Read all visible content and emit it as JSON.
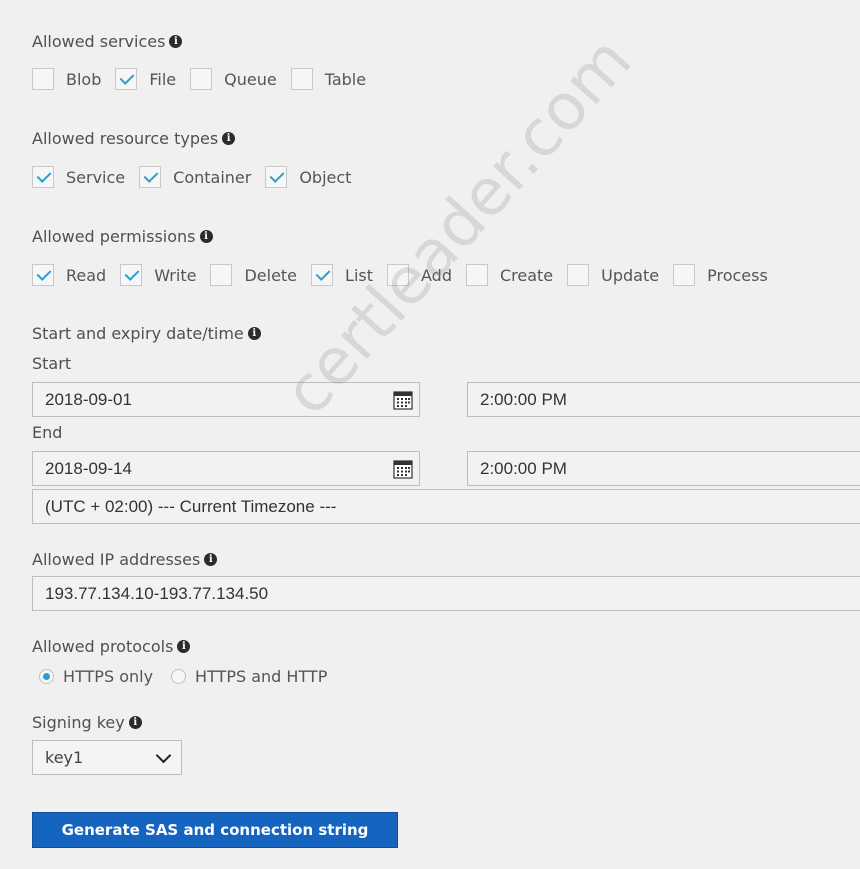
{
  "services": {
    "label": "Allowed services",
    "items": [
      {
        "label": "Blob",
        "checked": false
      },
      {
        "label": "File",
        "checked": true
      },
      {
        "label": "Queue",
        "checked": false
      },
      {
        "label": "Table",
        "checked": false
      }
    ]
  },
  "resource_types": {
    "label": "Allowed resource types",
    "items": [
      {
        "label": "Service",
        "checked": true
      },
      {
        "label": "Container",
        "checked": true
      },
      {
        "label": "Object",
        "checked": true
      }
    ]
  },
  "permissions": {
    "label": "Allowed permissions",
    "items": [
      {
        "label": "Read",
        "checked": true
      },
      {
        "label": "Write",
        "checked": true
      },
      {
        "label": "Delete",
        "checked": false
      },
      {
        "label": "List",
        "checked": true
      },
      {
        "label": "Add",
        "checked": false
      },
      {
        "label": "Create",
        "checked": false
      },
      {
        "label": "Update",
        "checked": false
      },
      {
        "label": "Process",
        "checked": false
      }
    ]
  },
  "datetime": {
    "label": "Start and expiry date/time",
    "start_label": "Start",
    "start_date": "2018-09-01",
    "start_time": "2:00:00 PM",
    "end_label": "End",
    "end_date": "2018-09-14",
    "end_time": "2:00:00 PM",
    "timezone": "(UTC + 02:00) --- Current Timezone ---"
  },
  "ip": {
    "label": "Allowed IP addresses",
    "value": "193.77.134.10-193.77.134.50"
  },
  "protocols": {
    "label": "Allowed protocols",
    "options": [
      {
        "label": "HTTPS only",
        "selected": true
      },
      {
        "label": "HTTPS and HTTP",
        "selected": false
      }
    ]
  },
  "signing_key": {
    "label": "Signing key",
    "value": "key1"
  },
  "generate_button": "Generate SAS and connection string",
  "watermark": "certleader.com",
  "colors": {
    "accent": "#2a9fcf",
    "button": "#1565c0",
    "background": "#f0f0f0"
  }
}
